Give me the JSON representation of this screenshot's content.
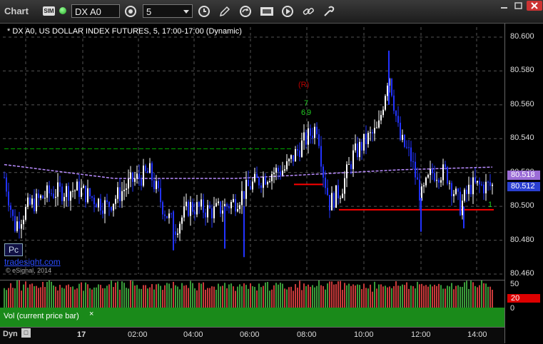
{
  "toolbar": {
    "title": "Chart",
    "badge": "SIM",
    "symbol": "DX A0",
    "interval": "5"
  },
  "chart": {
    "title": "* DX A0, US DOLLAR INDEX FUTURES, 5, 17:00-17:00 (Dynamic)",
    "pc_label": "Pc",
    "brand": "tradesight.com",
    "copyright": "© eSignal, 2014",
    "price_ticks": [
      "80.600",
      "80.580",
      "80.560",
      "80.540",
      "80.520",
      "80.500",
      "80.480",
      "80.460"
    ],
    "last_price_upper": "80.518",
    "last_price_lower": "80.512",
    "colors": {
      "up_bar": "#ffffff",
      "down_bar": "#2233ff",
      "avg_line": "#b98cff",
      "support": "#ff0000",
      "resistance": "#00aa00",
      "counts": "#22cc22"
    }
  },
  "volume": {
    "label": "Vol (current price bar)",
    "close_label": "×",
    "ticks": [
      "50",
      "0"
    ],
    "current_value": "20"
  },
  "time_axis": {
    "dyn_label": "Dyn",
    "day_label": "17",
    "ticks": [
      "02:00",
      "04:00",
      "06:00",
      "08:00",
      "10:00",
      "12:00",
      "14:00"
    ]
  },
  "chart_data": {
    "type": "candlestick",
    "title": "* DX A0, US DOLLAR INDEX FUTURES, 5, 17:00-17:00 (Dynamic)",
    "y_range": [
      80.46,
      80.6
    ],
    "y_ticks": [
      80.6,
      80.58,
      80.56,
      80.54,
      80.52,
      80.5,
      80.48,
      80.46
    ],
    "x_ticks": [
      "17",
      "02:00",
      "04:00",
      "06:00",
      "08:00",
      "10:00",
      "12:00",
      "14:00"
    ],
    "annotations": [
      "(R)",
      "7",
      "6",
      "9",
      "1"
    ],
    "levels": [
      {
        "color": "#00aa00",
        "style": "dashed",
        "price": 80.534
      },
      {
        "color": "#ff0000",
        "style": "solid",
        "price": 80.513
      },
      {
        "color": "#ff0000",
        "style": "solid",
        "price": 80.498
      }
    ],
    "last_price": 80.512,
    "grid": true
  }
}
